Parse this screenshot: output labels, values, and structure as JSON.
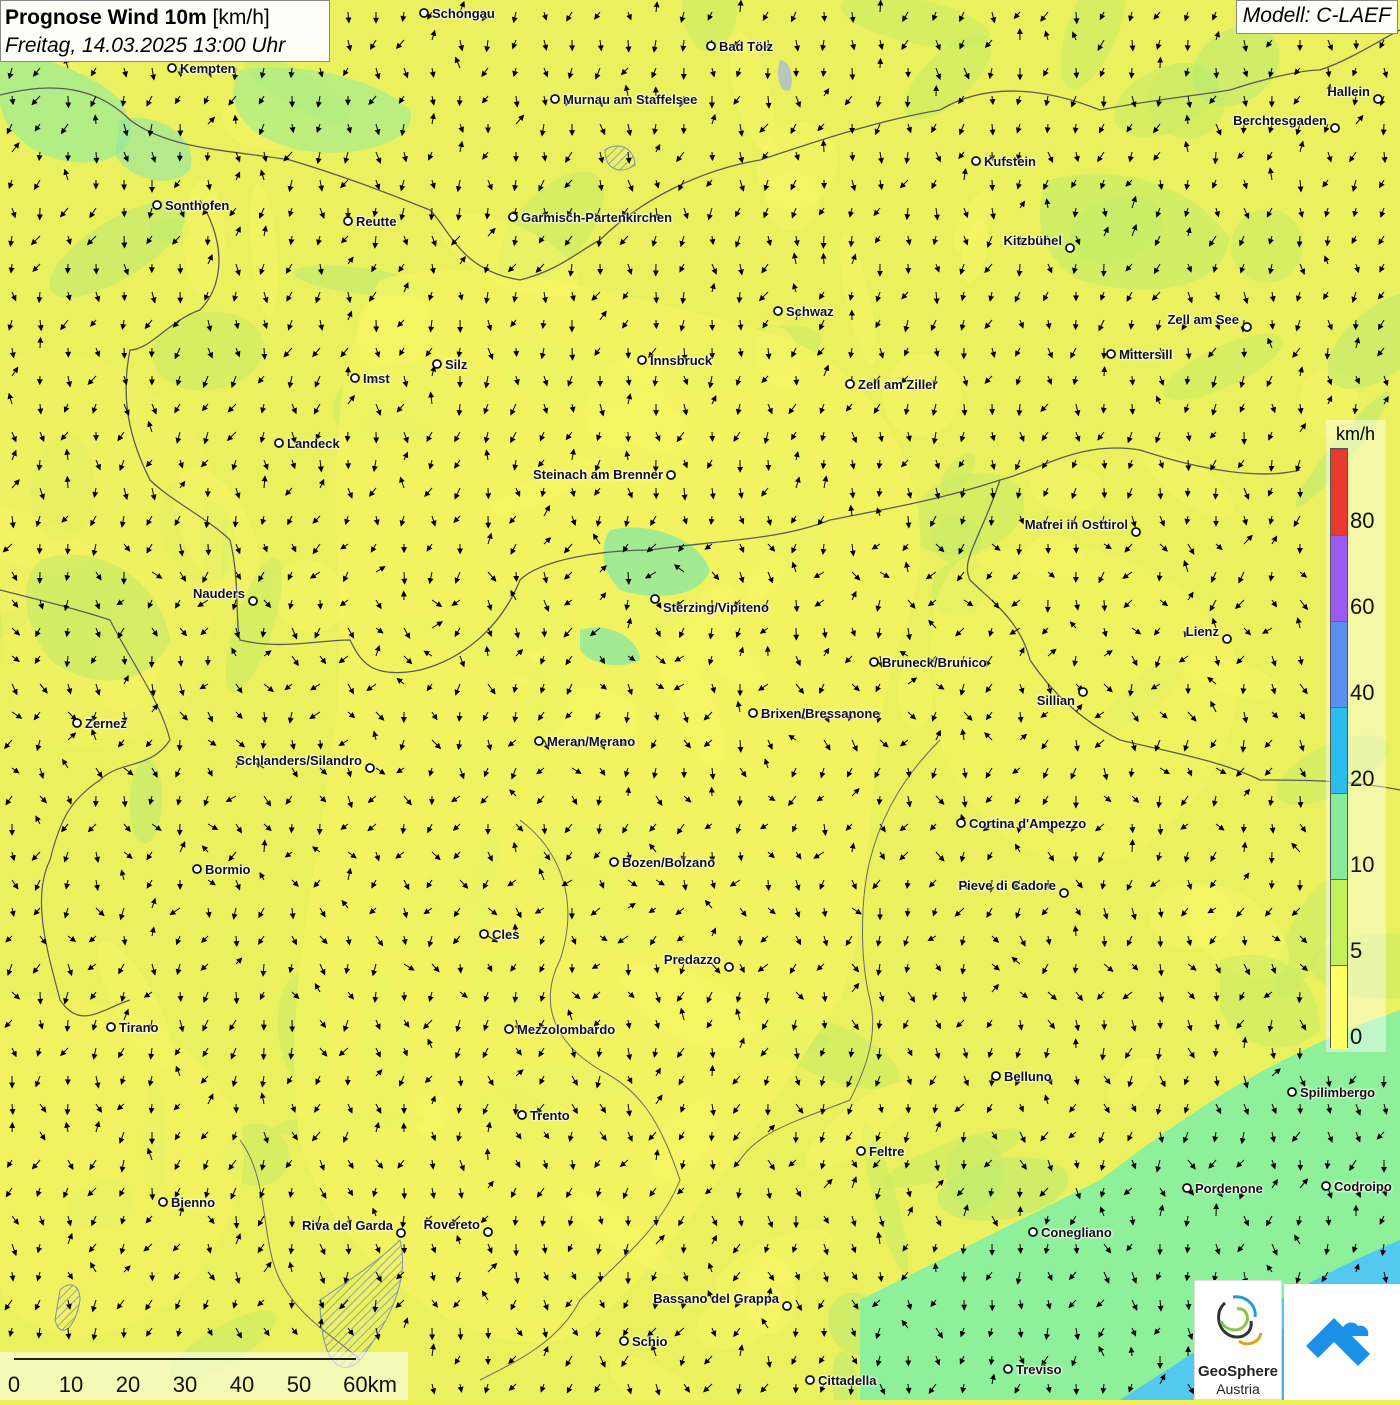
{
  "header": {
    "title_bold": "Prognose Wind 10m",
    "title_unit": "[km/h]",
    "datetime": "Freitag, 14.03.2025 13:00 Uhr",
    "model": "Modell: C-LAEF"
  },
  "legend": {
    "unit": "km/h",
    "ticks": [
      "80",
      "60",
      "40",
      "20",
      "10",
      "5",
      "0"
    ],
    "colors": [
      "#e83a2e",
      "#9a5cf0",
      "#5a8ff0",
      "#2bbcf0",
      "#8be99a",
      "#c4f05a",
      "#ffff66"
    ]
  },
  "scale": {
    "labels": [
      "0",
      "10",
      "20",
      "30",
      "40",
      "50",
      "60km"
    ]
  },
  "logo": {
    "line1": "GeoSphere",
    "line2": "Austria"
  },
  "cities": [
    {
      "name": "Schongau"
    },
    {
      "name": "Bad Tölz"
    },
    {
      "name": "Kempten"
    },
    {
      "name": "Murnau am Staffelsee"
    },
    {
      "name": "Hallein"
    },
    {
      "name": "Berchtesgaden"
    },
    {
      "name": "Kufstein"
    },
    {
      "name": "Sonthofen"
    },
    {
      "name": "Reutte"
    },
    {
      "name": "Garmisch-Partenkirchen"
    },
    {
      "name": "Kitzbühel"
    },
    {
      "name": "Schwaz"
    },
    {
      "name": "Zell am See"
    },
    {
      "name": "Mittersill"
    },
    {
      "name": "Innsbruck"
    },
    {
      "name": "Imst"
    },
    {
      "name": "Silz"
    },
    {
      "name": "Zell am Ziller"
    },
    {
      "name": "Landeck"
    },
    {
      "name": "Steinach am Brenner"
    },
    {
      "name": "Matrei in Osttirol"
    },
    {
      "name": "Nauders"
    },
    {
      "name": "Sterzing/Vipiteno"
    },
    {
      "name": "Lienz"
    },
    {
      "name": "Bruneck/Brunico"
    },
    {
      "name": "Sillian"
    },
    {
      "name": "Brixen/Bressanone"
    },
    {
      "name": "Zernez"
    },
    {
      "name": "Meran/Merano"
    },
    {
      "name": "Schlanders/Silandro"
    },
    {
      "name": "Cortina d'Ampezzo"
    },
    {
      "name": "Bozen/Bolzano"
    },
    {
      "name": "Bormio"
    },
    {
      "name": "Pieve di Cadore"
    },
    {
      "name": "Cles"
    },
    {
      "name": "Predazzo"
    },
    {
      "name": "Tirano"
    },
    {
      "name": "Mezzolombardo"
    },
    {
      "name": "Belluno"
    },
    {
      "name": "Spilimbergo"
    },
    {
      "name": "Trento"
    },
    {
      "name": "Feltre"
    },
    {
      "name": "Pordenone"
    },
    {
      "name": "Codroipo"
    },
    {
      "name": "Bienno"
    },
    {
      "name": "Riva del Garda"
    },
    {
      "name": "Rovereto"
    },
    {
      "name": "Conegliano"
    },
    {
      "name": "Bassano del Grappa"
    },
    {
      "name": "Schio"
    },
    {
      "name": "Treviso"
    },
    {
      "name": "Cittadella"
    }
  ]
}
